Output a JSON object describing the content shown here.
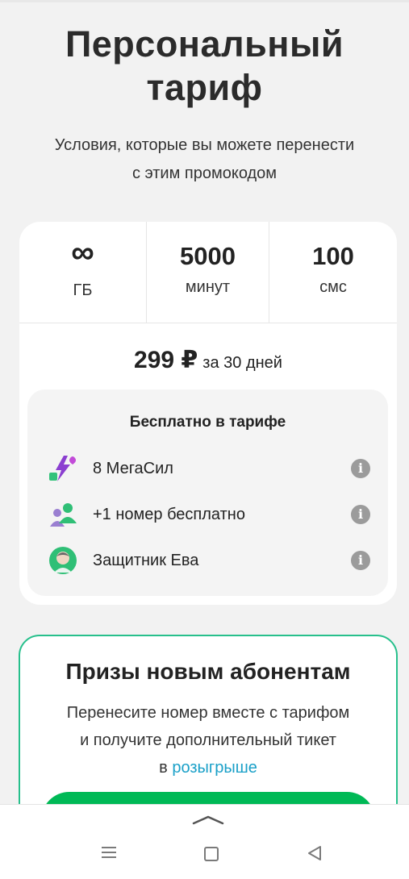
{
  "hero": {
    "title_line1": "Персональный",
    "title_line2": "тариф",
    "subtitle_line1": "Условия, которые вы можете перенести",
    "subtitle_line2": "с этим промокодом"
  },
  "tariff": {
    "stats": [
      {
        "value": "∞",
        "unit": "ГБ"
      },
      {
        "value": "5000",
        "unit": "минут"
      },
      {
        "value": "100",
        "unit": "смс"
      }
    ],
    "price": "299 ₽",
    "period": "за 30 дней",
    "free": {
      "title": "Бесплатно в тарифе",
      "items": [
        {
          "label": "8 МегаСил",
          "icon": "megasila-icon"
        },
        {
          "label": "+1 номер бесплатно",
          "icon": "extra-number-icon"
        },
        {
          "label": "Защитник Ева",
          "icon": "eva-avatar-icon"
        }
      ],
      "info_glyph": "i"
    }
  },
  "prizes": {
    "title": "Призы новым абонентам",
    "text_line1": "Перенесите номер вместе с тарифом",
    "text_line2": "и получите дополнительный тикет",
    "text_line3_prefix": "в ",
    "link": "розыгрыше"
  },
  "colors": {
    "accent_green": "#00b956",
    "border_green": "#27c08c",
    "link_blue": "#1aa0c8",
    "megasila_purple": "#8b3fd0"
  }
}
